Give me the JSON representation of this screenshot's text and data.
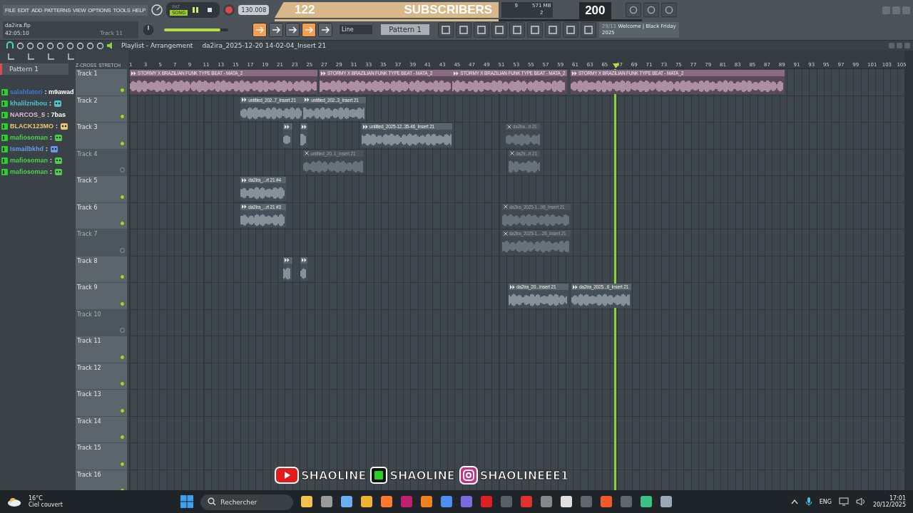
{
  "menu": [
    "FILE",
    "EDIT",
    "ADD",
    "PATTERNS",
    "VIEW",
    "OPTIONS",
    "TOOLS",
    "HELP"
  ],
  "mode_switch": [
    {
      "label": "PAT",
      "selected": false
    },
    {
      "label": "SONG",
      "selected": true
    }
  ],
  "tempo": "130.008",
  "project": {
    "file": "da2ira.flp",
    "time": "42:05:10",
    "hint": "Track 11"
  },
  "master_volume": {
    "level": 0.88
  },
  "monitor": {
    "cpu": "9",
    "memory": "571 MB",
    "polyphony": "2"
  },
  "snap": {
    "value": "Line"
  },
  "pattern_selector": {
    "value": "Pattern 1"
  },
  "news": {
    "date": "29/11",
    "text": "Welcome | Black Friday 2025"
  },
  "subscriber_goal": {
    "current": "122",
    "label": "SUBSCRIBERS",
    "target": "200",
    "level": 0.61
  },
  "pattern_list": [
    "Pattern 1"
  ],
  "playlist": {
    "title": "Playlist - Arrangement",
    "path": "da2ira_2025-12-20 14-02-04_Insert 21",
    "toggles": [
      "Z-CROSS",
      "STRETCH"
    ],
    "ruler": [
      "1",
      "3",
      "5",
      "7",
      "9",
      "11",
      "13",
      "15",
      "17",
      "19",
      "21",
      "23",
      "25",
      "27",
      "29",
      "31",
      "33",
      "35",
      "37",
      "39",
      "41",
      "43",
      "45",
      "47",
      "49",
      "51",
      "53",
      "55",
      "57",
      "59",
      "61",
      "63",
      "65",
      "67",
      "69",
      "71",
      "73",
      "75",
      "77",
      "79",
      "81",
      "83",
      "85",
      "87",
      "89",
      "91",
      "93",
      "95",
      "97",
      "99",
      "101",
      "103",
      "105"
    ],
    "tracks": [
      {
        "name": "Track 1",
        "muted": false,
        "clips": [
          {
            "name": "STORMY X BRAZILIAN FUNK TYPE BEAT - MATA_2",
            "muted": false
          },
          {
            "name": "STORMY X BRAZILIAN FUNK TYPE BEAT - MATA_2",
            "muted": false
          },
          {
            "name": "STORMY X BRAZILIAN FUNK TYPE BEAT - MATA_2",
            "muted": false
          },
          {
            "name": "STORMY X BRAZILIAN FUNK TYPE BEAT - MATA_2",
            "muted": false
          }
        ]
      },
      {
        "name": "Track 2",
        "muted": false,
        "clips": [
          {
            "name": "untitled_202..7_Insert 21",
            "muted": false
          },
          {
            "name": "untitled_202..3_Insert 21",
            "muted": false
          }
        ]
      },
      {
        "name": "Track 3",
        "muted": false,
        "clips": [
          {
            "muted": false
          },
          {
            "muted": false
          },
          {
            "name": "untitled_2025-12..35-46_Insert 21",
            "muted": false
          },
          {
            "name": "da2ira...rt 21",
            "muted": true
          }
        ]
      },
      {
        "name": "Track 4",
        "muted": true,
        "clips": [
          {
            "name": "untitled_20..1_Insert 21",
            "muted": true
          },
          {
            "name": "da2ir...rt 21",
            "muted": true
          }
        ]
      },
      {
        "name": "Track 5",
        "muted": false,
        "clips": [
          {
            "name": "da2ira_...rt 21 #4",
            "muted": false
          }
        ]
      },
      {
        "name": "Track 6",
        "muted": false,
        "clips": [
          {
            "name": "da2ira_...rt 21 #3",
            "muted": false
          },
          {
            "name": "da2ira_2025-1...06_Insert 21",
            "muted": true
          }
        ]
      },
      {
        "name": "Track 7",
        "muted": true,
        "clips": [
          {
            "name": "da2ira_2025-1...-26_Insert 21",
            "muted": true
          }
        ]
      },
      {
        "name": "Track 8",
        "muted": false,
        "clips": [
          {
            "muted": false
          },
          {
            "muted": false
          }
        ]
      },
      {
        "name": "Track 9",
        "muted": false,
        "clips": [
          {
            "name": "da2ira_20...Insert 21",
            "muted": false
          },
          {
            "name": "da2ira_2025...6_Insert 21",
            "muted": false
          }
        ]
      },
      {
        "name": "Track 10",
        "muted": true
      },
      {
        "name": "Track 11",
        "muted": false
      },
      {
        "name": "Track 12",
        "muted": false
      },
      {
        "name": "Track 13",
        "muted": false
      },
      {
        "name": "Track 14",
        "muted": false
      },
      {
        "name": "Track 15",
        "muted": false
      },
      {
        "name": "Track 16",
        "muted": false
      }
    ]
  },
  "chat": [
    {
      "user": "salahfatori",
      "color": "#3f78d8",
      "kind": "text",
      "text": ": m9awad"
    },
    {
      "user": "khalilznibou",
      "color": "#4fc3c8",
      "kind": "emote",
      "text": ":"
    },
    {
      "user": "NARCOS_5",
      "color": "#e8b8d0",
      "kind": "text",
      "text": ": 7bas"
    },
    {
      "user": "BLACK123MO",
      "color": "#e8c870",
      "kind": "emote",
      "text": ":"
    },
    {
      "user": "mafiosoman",
      "color": "#4cd04c",
      "kind": "emote",
      "text": ":"
    },
    {
      "user": "Ismailbkhd",
      "color": "#6a98e8",
      "kind": "emote",
      "text": ":"
    },
    {
      "user": "mafiosoman",
      "color": "#4cd04c",
      "kind": "emote",
      "text": ":"
    },
    {
      "user": "mafiosoman",
      "color": "#4cd04c",
      "kind": "emote",
      "text": ":"
    }
  ],
  "socials": [
    {
      "kind": "youtube",
      "handle": "SHAOLINE"
    },
    {
      "kind": "kick",
      "handle": "SHAOLINE"
    },
    {
      "kind": "instagram",
      "handle": "SHAOLINEEE1"
    }
  ],
  "taskbar": {
    "weather": {
      "temp": "16°C",
      "desc": "Ciel couvert"
    },
    "search": {
      "placeholder": "Rechercher"
    },
    "language": "ENG",
    "time": "17:01",
    "date": "20/12/2025"
  }
}
